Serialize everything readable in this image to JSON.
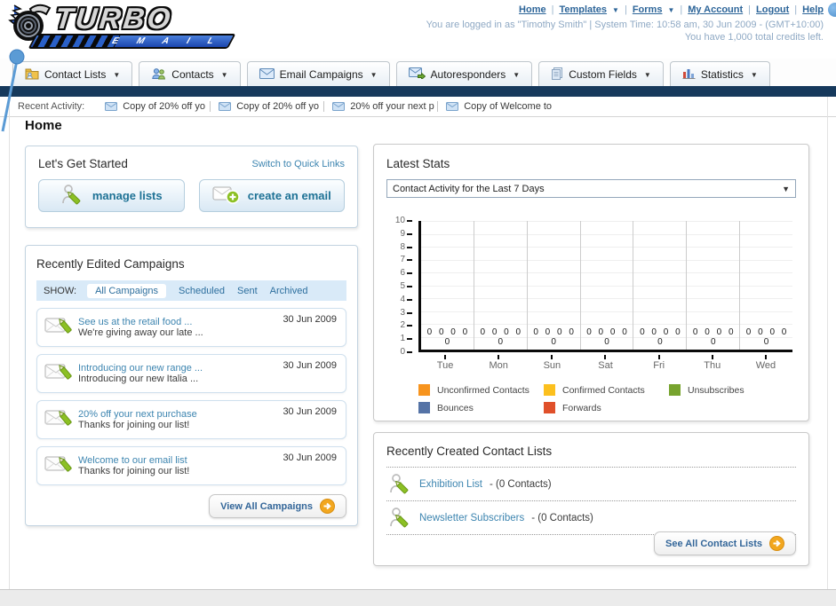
{
  "header": {
    "logo": {
      "title": "TURBO",
      "subtitle": "E M A I L"
    },
    "nav": [
      {
        "label": "Home",
        "dropdown": false
      },
      {
        "label": "Templates",
        "dropdown": true
      },
      {
        "label": "Forms",
        "dropdown": true
      },
      {
        "label": "My Account",
        "dropdown": false
      },
      {
        "label": "Logout",
        "dropdown": false
      },
      {
        "label": "Help",
        "dropdown": false
      }
    ],
    "login_info": "You are logged in as \"Timothy Smith\" | System Time: 10:58 am, 30 Jun 2009 - (GMT+10:00)",
    "credits_info": "You have 1,000 total credits left."
  },
  "nav_tabs": [
    {
      "label": "Contact Lists",
      "icon": "contact-lists-icon"
    },
    {
      "label": "Contacts",
      "icon": "contacts-icon"
    },
    {
      "label": "Email Campaigns",
      "icon": "email-campaigns-icon"
    },
    {
      "label": "Autoresponders",
      "icon": "autoresponders-icon"
    },
    {
      "label": "Custom Fields",
      "icon": "custom-fields-icon"
    },
    {
      "label": "Statistics",
      "icon": "statistics-icon"
    }
  ],
  "recent_activity": {
    "label": "Recent Activity:",
    "items": [
      "Copy of 20% off yo",
      "Copy of 20% off yo",
      "20% off your next p",
      "Copy of Welcome to"
    ]
  },
  "page_title": "Home",
  "get_started": {
    "title": "Let's Get Started",
    "switch_link": "Switch to Quick Links",
    "manage_lists_label": "manage lists",
    "create_email_label": "create an email"
  },
  "campaigns": {
    "title": "Recently Edited Campaigns",
    "show_label": "SHOW:",
    "filters": [
      "All Campaigns",
      "Scheduled",
      "Sent",
      "Archived"
    ],
    "active_filter": "All Campaigns",
    "items": [
      {
        "title": "See us at the retail food ...",
        "subtitle": "We're giving away our late ...",
        "date": "30 Jun 2009"
      },
      {
        "title": "Introducing our new range ...",
        "subtitle": "Introducing our new Italia ...",
        "date": "30 Jun 2009"
      },
      {
        "title": "20% off your next purchase",
        "subtitle": "Thanks for joining our list!",
        "date": "30 Jun 2009"
      },
      {
        "title": "Welcome to our email list",
        "subtitle": "Thanks for joining our list!",
        "date": "30 Jun 2009"
      }
    ],
    "view_all_label": "View All Campaigns"
  },
  "stats": {
    "title": "Latest Stats",
    "dropdown_value": "Contact Activity for the Last 7 Days",
    "chart_data": {
      "type": "bar",
      "categories": [
        "Tue",
        "Mon",
        "Sun",
        "Sat",
        "Fri",
        "Thu",
        "Wed"
      ],
      "series": [
        {
          "name": "Unconfirmed Contacts",
          "color": "#F7941E",
          "values": [
            0,
            0,
            0,
            0,
            0,
            0,
            0
          ]
        },
        {
          "name": "Confirmed Contacts",
          "color": "#FCC01E",
          "values": [
            0,
            0,
            0,
            0,
            0,
            0,
            0
          ]
        },
        {
          "name": "Unsubscribes",
          "color": "#77A32E",
          "values": [
            0,
            0,
            0,
            0,
            0,
            0,
            0
          ]
        },
        {
          "name": "Bounces",
          "color": "#5573A6",
          "values": [
            0,
            0,
            0,
            0,
            0,
            0,
            0
          ]
        },
        {
          "name": "Forwards",
          "color": "#E0502A",
          "values": [
            0,
            0,
            0,
            0,
            0,
            0,
            0
          ]
        }
      ],
      "ylim": [
        0,
        10
      ],
      "ytick_step": 1,
      "grid": true,
      "legend_position": "bottom"
    }
  },
  "contact_lists": {
    "title": "Recently Created Contact Lists",
    "items": [
      {
        "name": "Exhibition List",
        "count": "- (0 Contacts)"
      },
      {
        "name": "Newsletter Subscribers",
        "count": "- (0 Contacts)"
      }
    ],
    "see_all_label": "See All Contact Lists"
  }
}
